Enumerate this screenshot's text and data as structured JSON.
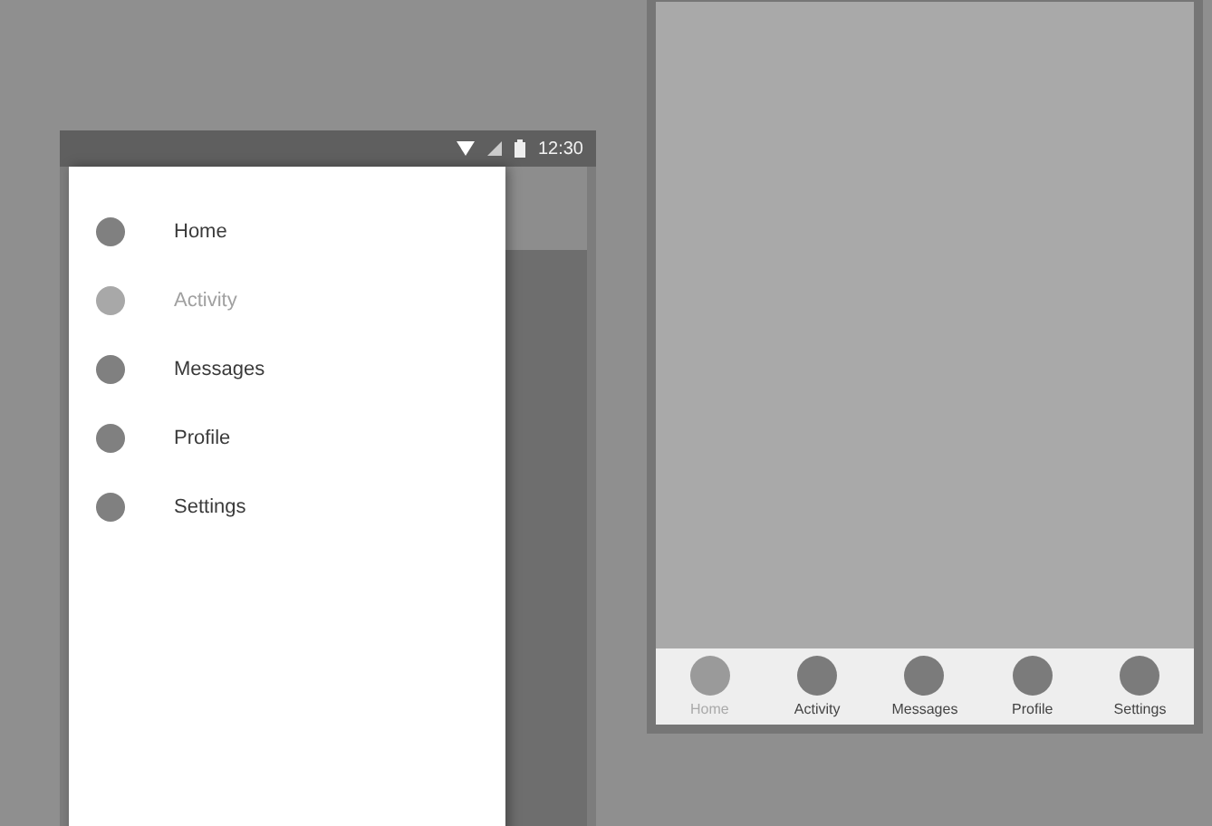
{
  "left_phone": {
    "status_bar": {
      "time": "12:30"
    },
    "drawer": {
      "items": [
        {
          "label": "Home",
          "selected": false
        },
        {
          "label": "Activity",
          "selected": true
        },
        {
          "label": "Messages",
          "selected": false
        },
        {
          "label": "Profile",
          "selected": false
        },
        {
          "label": "Settings",
          "selected": false
        }
      ]
    }
  },
  "right_phone": {
    "tab_bar": {
      "items": [
        {
          "label": "Home",
          "selected": true
        },
        {
          "label": "Activity",
          "selected": false
        },
        {
          "label": "Messages",
          "selected": false
        },
        {
          "label": "Profile",
          "selected": false
        },
        {
          "label": "Settings",
          "selected": false
        }
      ]
    }
  }
}
